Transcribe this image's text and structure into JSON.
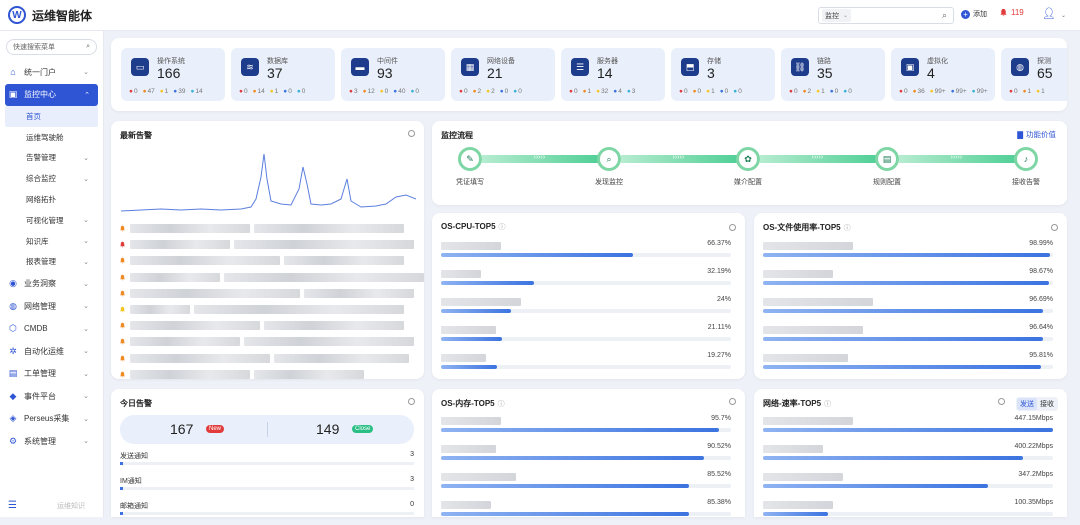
{
  "app": {
    "title": "运维智能体"
  },
  "topbar": {
    "search_select": "监控",
    "add_label": "添加",
    "alert_count": "119"
  },
  "sidebar": {
    "search_placeholder": "快速搜索菜单",
    "items": [
      {
        "label": "统一门户",
        "icon": "home-icon"
      },
      {
        "label": "监控中心",
        "icon": "monitor-icon",
        "active": true
      },
      {
        "label": "首页",
        "sub": true,
        "selected": true
      },
      {
        "label": "运维驾驶舱",
        "sub": true
      },
      {
        "label": "告警管理",
        "sub": true
      },
      {
        "label": "综合监控",
        "sub": true
      },
      {
        "label": "网络拓扑",
        "sub": true
      },
      {
        "label": "可视化管理",
        "sub": true
      },
      {
        "label": "知识库",
        "sub": true
      },
      {
        "label": "报表管理",
        "sub": true
      },
      {
        "label": "业务洞察",
        "icon": "insight-icon"
      },
      {
        "label": "网络管理",
        "icon": "network-icon"
      },
      {
        "label": "CMDB",
        "icon": "cmdb-icon"
      },
      {
        "label": "自动化运维",
        "icon": "automation-icon"
      },
      {
        "label": "工单管理",
        "icon": "ticket-icon"
      },
      {
        "label": "事件平台",
        "icon": "event-icon"
      },
      {
        "label": "Perseus采集",
        "icon": "collect-icon"
      },
      {
        "label": "系统管理",
        "icon": "settings-icon"
      }
    ],
    "footer_label": "运维知识"
  },
  "stats": [
    {
      "name": "操作系统",
      "value": "166",
      "counts": [
        "0",
        "47",
        "1",
        "39",
        "14"
      ],
      "icon": "os-icon"
    },
    {
      "name": "数据库",
      "value": "37",
      "counts": [
        "0",
        "14",
        "1",
        "0",
        "0"
      ],
      "icon": "database-icon"
    },
    {
      "name": "中间件",
      "value": "93",
      "counts": [
        "3",
        "12",
        "0",
        "40",
        "0"
      ],
      "icon": "middleware-icon"
    },
    {
      "name": "网络设备",
      "value": "21",
      "counts": [
        "0",
        "2",
        "2",
        "0",
        "0"
      ],
      "icon": "network-device-icon"
    },
    {
      "name": "服务器",
      "value": "14",
      "counts": [
        "0",
        "1",
        "32",
        "4",
        "3"
      ],
      "icon": "server-icon"
    },
    {
      "name": "存储",
      "value": "3",
      "counts": [
        "0",
        "0",
        "1",
        "0",
        "0"
      ],
      "icon": "storage-icon"
    },
    {
      "name": "链路",
      "value": "35",
      "counts": [
        "0",
        "2",
        "1",
        "0",
        "0"
      ],
      "icon": "link-icon"
    },
    {
      "name": "虚拟化",
      "value": "4",
      "counts": [
        "0",
        "36",
        "99+",
        "99+",
        "99+"
      ],
      "icon": "virtualization-icon"
    },
    {
      "name": "探测",
      "value": "65",
      "counts": [
        "0",
        "1",
        "1"
      ],
      "icon": "probe-icon"
    }
  ],
  "status_colors": [
    "#e23b3b",
    "#f08a24",
    "#f3c623",
    "#3b73e0",
    "#36b2d6"
  ],
  "latest_alerts": {
    "title": "最新告警",
    "bell_colors": [
      "#f08a24",
      "#e23b3b",
      "#f08a24",
      "#f08a24",
      "#f08a24",
      "#f3c623",
      "#f08a24",
      "#f08a24",
      "#f08a24",
      "#f08a24"
    ]
  },
  "flow": {
    "title": "监控流程",
    "link": "功能价值",
    "steps": [
      {
        "label": "凭证填写",
        "icon": "form-icon"
      },
      {
        "label": "发现监控",
        "icon": "discover-icon"
      },
      {
        "label": "媒介配置",
        "icon": "media-icon"
      },
      {
        "label": "规则配置",
        "icon": "rule-icon"
      },
      {
        "label": "接收告警",
        "icon": "bell-icon"
      }
    ]
  },
  "cpu_top5": {
    "title": "OS-CPU-TOP5",
    "values": [
      "66.37%",
      "32.19%",
      "24%",
      "21.11%",
      "19.27%"
    ],
    "pct": [
      66.37,
      32.19,
      24,
      21.11,
      19.27
    ]
  },
  "fs_top5": {
    "title": "OS-文件使用率-TOP5",
    "values": [
      "98.99%",
      "98.67%",
      "96.69%",
      "96.64%",
      "95.81%"
    ],
    "pct": [
      98.99,
      98.67,
      96.69,
      96.64,
      95.81
    ]
  },
  "mem_top5": {
    "title": "OS-内存-TOP5",
    "values": [
      "95.7%",
      "90.52%",
      "85.52%",
      "85.38%"
    ],
    "pct": [
      95.7,
      90.52,
      85.52,
      85.38
    ]
  },
  "net_top5": {
    "title": "网络-速率-TOP5",
    "send": "发送",
    "recv": "接收",
    "values": [
      "447.15Mbps",
      "400.22Mbps",
      "347.2Mbps",
      "100.35Mbps"
    ],
    "pct": [
      100,
      89.5,
      77.6,
      22.4
    ]
  },
  "today": {
    "title": "今日告警",
    "new_count": "167",
    "new_tag": "New",
    "close_count": "149",
    "close_tag": "Close",
    "notifications": [
      {
        "label": "发送通知",
        "value": "3"
      },
      {
        "label": "IM通知",
        "value": "3"
      },
      {
        "label": "邮箱通知",
        "value": "0"
      }
    ]
  }
}
